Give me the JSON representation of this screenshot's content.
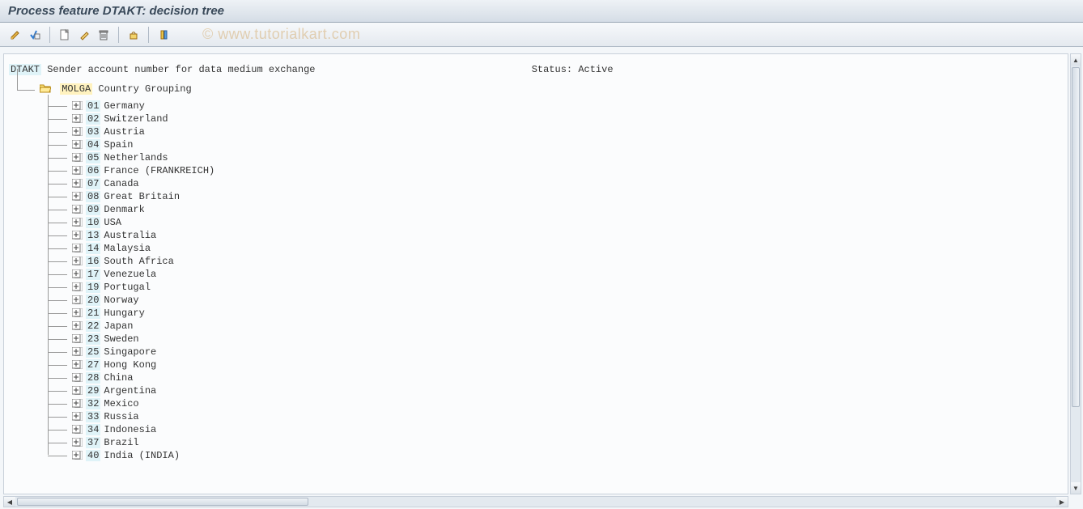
{
  "title": "Process feature DTAKT: decision tree",
  "watermark": "© www.tutorialkart.com",
  "toolbar": {
    "icons": [
      "edit",
      "check",
      "new",
      "pencil",
      "delete",
      "lock",
      "column"
    ]
  },
  "header": {
    "feature_code": "DTAKT",
    "feature_desc": "Sender account number for data medium exchange",
    "status_label": "Status:",
    "status_value": "Active"
  },
  "grouping": {
    "code": "MOLGA",
    "desc": "Country Grouping"
  },
  "items": [
    {
      "code": "01",
      "label": "Germany"
    },
    {
      "code": "02",
      "label": "Switzerland"
    },
    {
      "code": "03",
      "label": "Austria"
    },
    {
      "code": "04",
      "label": "Spain"
    },
    {
      "code": "05",
      "label": "Netherlands"
    },
    {
      "code": "06",
      "label": "France (FRANKREICH)"
    },
    {
      "code": "07",
      "label": "Canada"
    },
    {
      "code": "08",
      "label": "Great Britain"
    },
    {
      "code": "09",
      "label": "Denmark"
    },
    {
      "code": "10",
      "label": "USA"
    },
    {
      "code": "13",
      "label": "Australia"
    },
    {
      "code": "14",
      "label": "Malaysia"
    },
    {
      "code": "16",
      "label": "South Africa"
    },
    {
      "code": "17",
      "label": "Venezuela"
    },
    {
      "code": "19",
      "label": "Portugal"
    },
    {
      "code": "20",
      "label": "Norway"
    },
    {
      "code": "21",
      "label": "Hungary"
    },
    {
      "code": "22",
      "label": "Japan"
    },
    {
      "code": "23",
      "label": "Sweden"
    },
    {
      "code": "25",
      "label": "Singapore"
    },
    {
      "code": "27",
      "label": "Hong Kong"
    },
    {
      "code": "28",
      "label": "China"
    },
    {
      "code": "29",
      "label": "Argentina"
    },
    {
      "code": "32",
      "label": "Mexico"
    },
    {
      "code": "33",
      "label": "Russia"
    },
    {
      "code": "34",
      "label": "Indonesia"
    },
    {
      "code": "37",
      "label": "Brazil"
    },
    {
      "code": "40",
      "label": "India (INDIA)"
    }
  ]
}
